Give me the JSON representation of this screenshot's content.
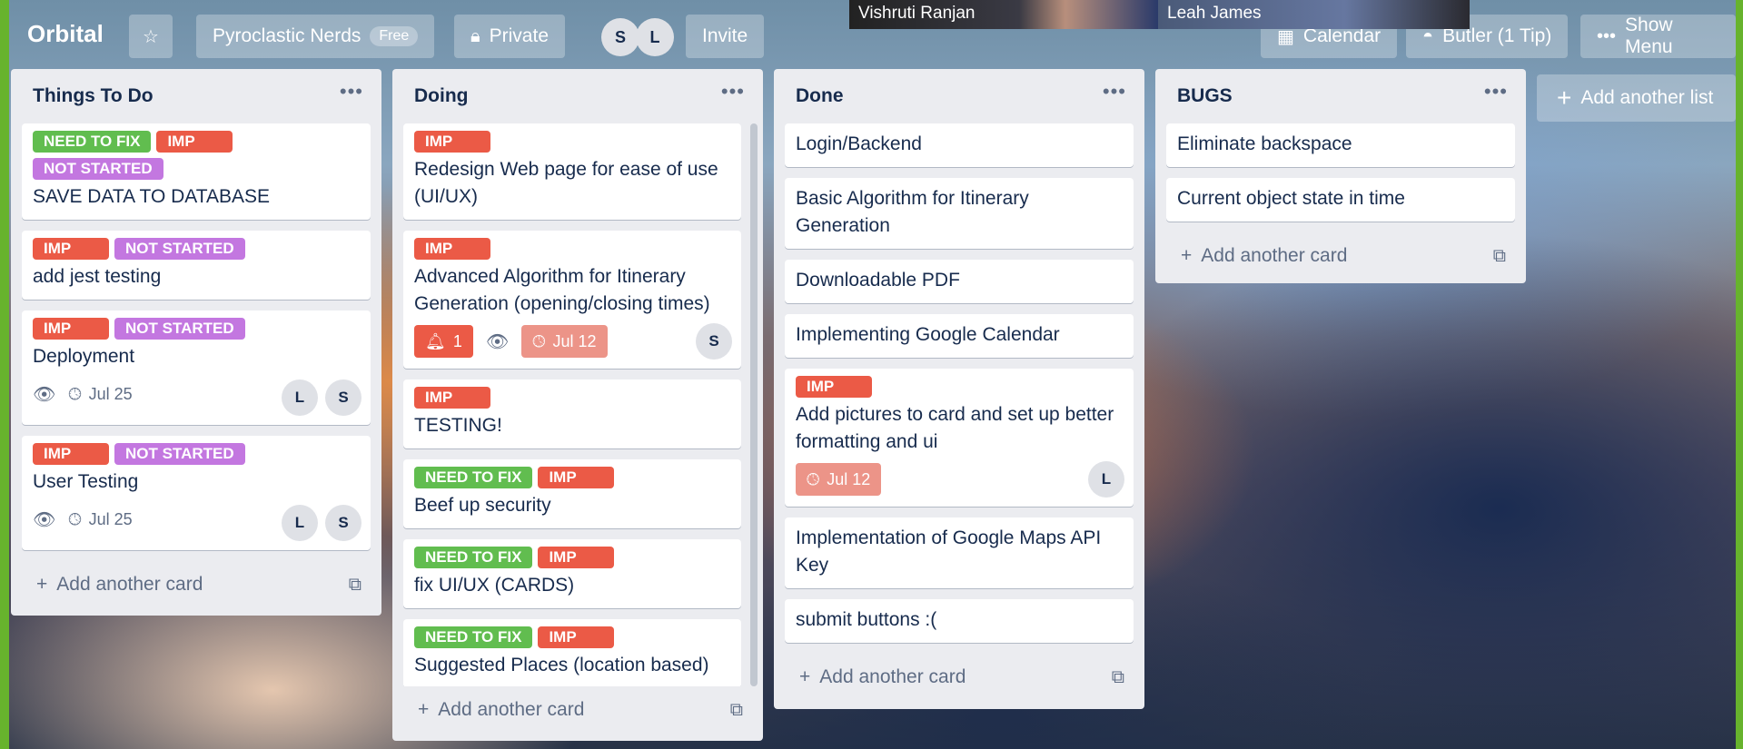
{
  "header": {
    "board_title": "Orbital",
    "star_icon": "star-icon",
    "team_name": "Pyroclastic Nerds",
    "team_badge": "Free",
    "visibility_label": "Private",
    "visibility_icon": "lock-icon",
    "members": [
      "S",
      "L"
    ],
    "invite_label": "Invite",
    "calendar_label": "Calendar",
    "calendar_icon": "calendar-icon",
    "butler_label": "Butler (1 Tip)",
    "butler_icon": "butler-icon",
    "show_menu_label": "Show Menu",
    "more_icon": "ellipsis-icon"
  },
  "video_call": {
    "participants": [
      "Vishruti Ranjan",
      "Leah James"
    ]
  },
  "colors": {
    "label_green": "#61bd4f",
    "label_red": "#eb5a46",
    "label_purple": "#c377e0",
    "due_soon": "#ec9488",
    "list_bg": "#ebecf0",
    "text": "#172b4d"
  },
  "lists": [
    {
      "title": "Things To Do",
      "add_card_label": "Add another card",
      "cards": [
        {
          "labels": [
            "NEED TO FIX",
            "IMP",
            "NOT STARTED"
          ],
          "title": "SAVE DATA TO DATABASE"
        },
        {
          "labels": [
            "IMP",
            "NOT STARTED"
          ],
          "title": "add jest testing"
        },
        {
          "labels": [
            "IMP",
            "NOT STARTED"
          ],
          "title": "Deployment",
          "due": "Jul 25",
          "members": [
            "L",
            "S"
          ]
        },
        {
          "labels": [
            "IMP",
            "NOT STARTED"
          ],
          "title": "User Testing",
          "due": "Jul 25",
          "members": [
            "L",
            "S"
          ]
        }
      ]
    },
    {
      "title": "Doing",
      "add_card_label": "Add another card",
      "cards": [
        {
          "labels": [
            "IMP"
          ],
          "title": "Redesign Web page for ease of use (UI/UX)"
        },
        {
          "labels": [
            "IMP"
          ],
          "title": "Advanced Algorithm for Itinerary Generation (opening/closing times)",
          "notifications": "1",
          "due": "Jul 12",
          "members": [
            "S"
          ]
        },
        {
          "labels": [
            "IMP"
          ],
          "title": "TESTING!"
        },
        {
          "labels": [
            "NEED TO FIX",
            "IMP"
          ],
          "title": "Beef up security"
        },
        {
          "labels": [
            "NEED TO FIX",
            "IMP"
          ],
          "title": "fix UI/UX (CARDS)"
        },
        {
          "labels": [
            "NEED TO FIX",
            "IMP"
          ],
          "title": "Suggested Places (location based)"
        }
      ]
    },
    {
      "title": "Done",
      "add_card_label": "Add another card",
      "cards": [
        {
          "labels": [],
          "title": "Login/Backend"
        },
        {
          "labels": [],
          "title": "Basic Algorithm for Itinerary Generation"
        },
        {
          "labels": [],
          "title": "Downloadable PDF"
        },
        {
          "labels": [],
          "title": "Implementing Google Calendar"
        },
        {
          "labels": [
            "IMP"
          ],
          "title": "Add pictures to card and set up better formatting and ui",
          "due": "Jul 12",
          "members": [
            "L"
          ]
        },
        {
          "labels": [],
          "title": "Implementation of Google Maps API Key"
        },
        {
          "labels": [],
          "title": "submit buttons :("
        }
      ]
    },
    {
      "title": "BUGS",
      "add_card_label": "Add another card",
      "cards": [
        {
          "labels": [],
          "title": "Eliminate backspace"
        },
        {
          "labels": [],
          "title": "Current object state in time"
        }
      ]
    }
  ],
  "add_list_label": "Add another list"
}
